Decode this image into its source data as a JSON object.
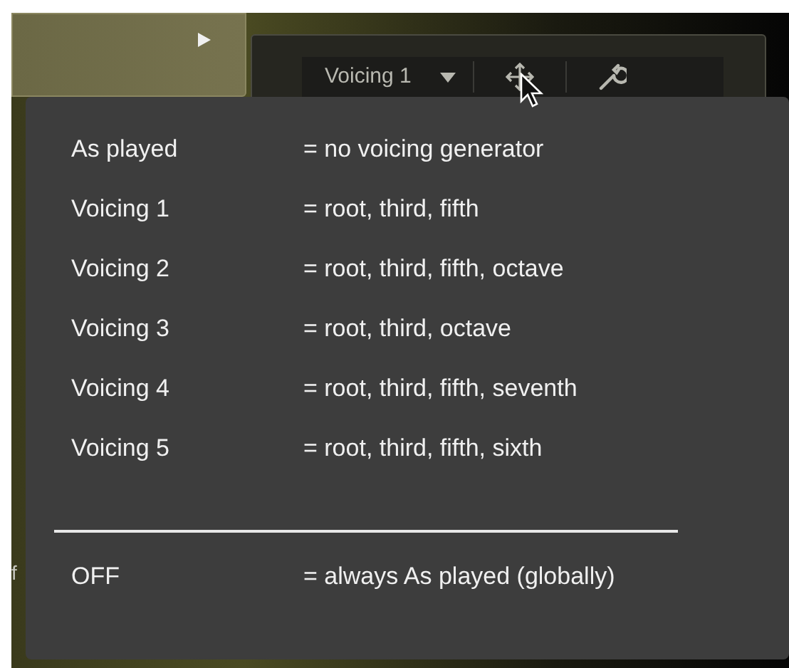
{
  "toolbar": {
    "voicing_selector": {
      "value": "Voicing 1"
    }
  },
  "side_fragment": {
    "text": "f"
  },
  "menu": {
    "items": [
      {
        "label": "As played",
        "description": "= no voicing generator"
      },
      {
        "label": "Voicing 1",
        "description": "= root, third, fifth"
      },
      {
        "label": "Voicing 2",
        "description": "= root, third, fifth, octave"
      },
      {
        "label": "Voicing 3",
        "description": "= root, third, octave"
      },
      {
        "label": "Voicing 4",
        "description": "= root, third, fifth, seventh"
      },
      {
        "label": "Voicing 5",
        "description": "= root, third, fifth, sixth"
      }
    ],
    "footer": {
      "label": "OFF",
      "description": "= always As played (globally)"
    }
  }
}
